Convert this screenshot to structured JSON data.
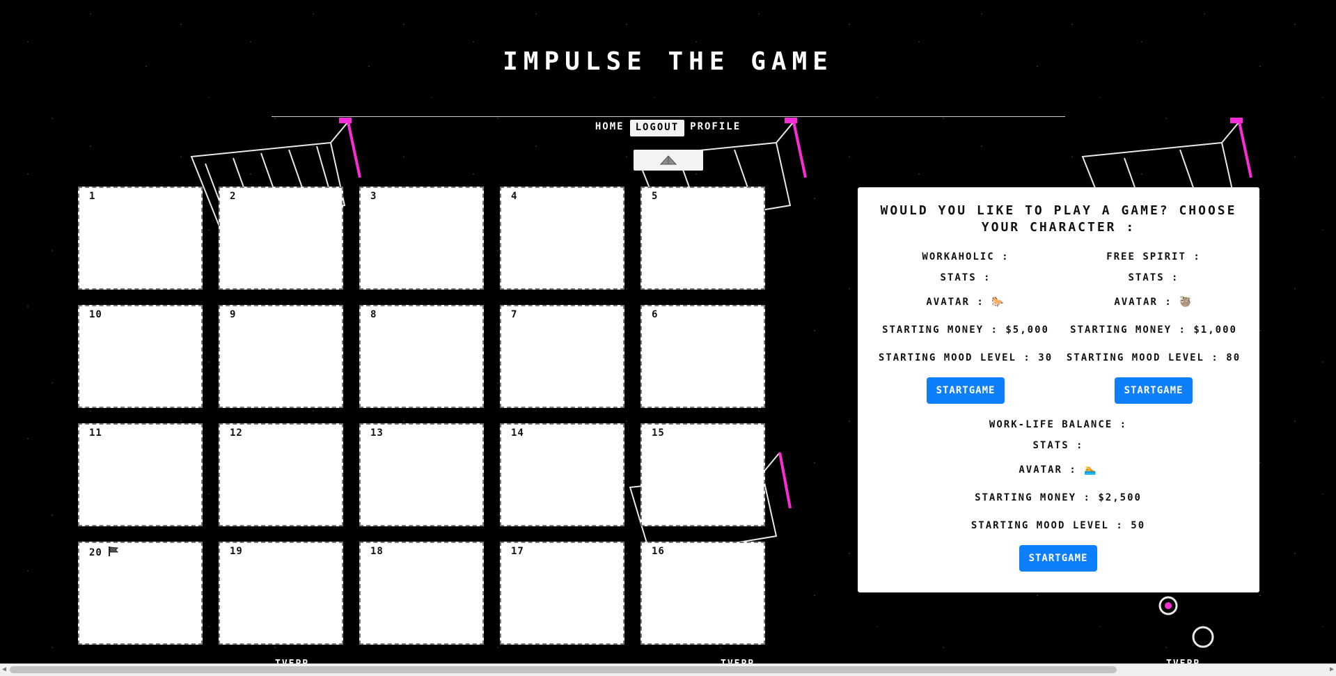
{
  "title": "IMPULSE THE GAME",
  "nav": {
    "home": "HOME",
    "logout": "LOGOUT",
    "profile": "PROFILE"
  },
  "toggle": {
    "icon": "caret-toggle-icon"
  },
  "board": {
    "tiles": [
      "1",
      "2",
      "3",
      "4",
      "5",
      "10",
      "9",
      "8",
      "7",
      "6",
      "11",
      "12",
      "13",
      "14",
      "15",
      "20",
      "19",
      "18",
      "17",
      "16"
    ],
    "flag_tile": "20",
    "flag_icon": "flag-icon"
  },
  "panel": {
    "question": "WOULD YOU LIKE TO PLAY A GAME? CHOOSE YOUR CHARACTER :",
    "characters": [
      {
        "name": "WORKAHOLIC :",
        "stats": "STATS :",
        "avatar_label": "AVATAR :",
        "avatar_icon": "horse-icon",
        "avatar_glyph": "🐎",
        "money": "STARTING MONEY : $5,000",
        "mood": "STARTING MOOD LEVEL : 30",
        "button": "STARTGAME"
      },
      {
        "name": "FREE SPIRIT :",
        "stats": "STATS :",
        "avatar_label": "AVATAR :",
        "avatar_icon": "sloth-icon",
        "avatar_glyph": "🦥",
        "money": "STARTING MONEY : $1,000",
        "mood": "STARTING MOOD LEVEL : 80",
        "button": "STARTGAME"
      },
      {
        "name": "WORK-LIFE BALANCE :",
        "stats": "STATS :",
        "avatar_label": "AVATAR :",
        "avatar_icon": "swimmer-icon",
        "avatar_glyph": "🏊",
        "money": "STARTING MONEY : $2,500",
        "mood": "STARTING MOOD LEVEL : 50",
        "button": "STARTGAME"
      }
    ]
  },
  "footer_fragments": [
    "TVEPP",
    "TVEPP",
    "TVEPP"
  ],
  "colors": {
    "accent": "#0d7ffb",
    "background": "#000000",
    "cart_magenta": "#ff2bd6"
  }
}
